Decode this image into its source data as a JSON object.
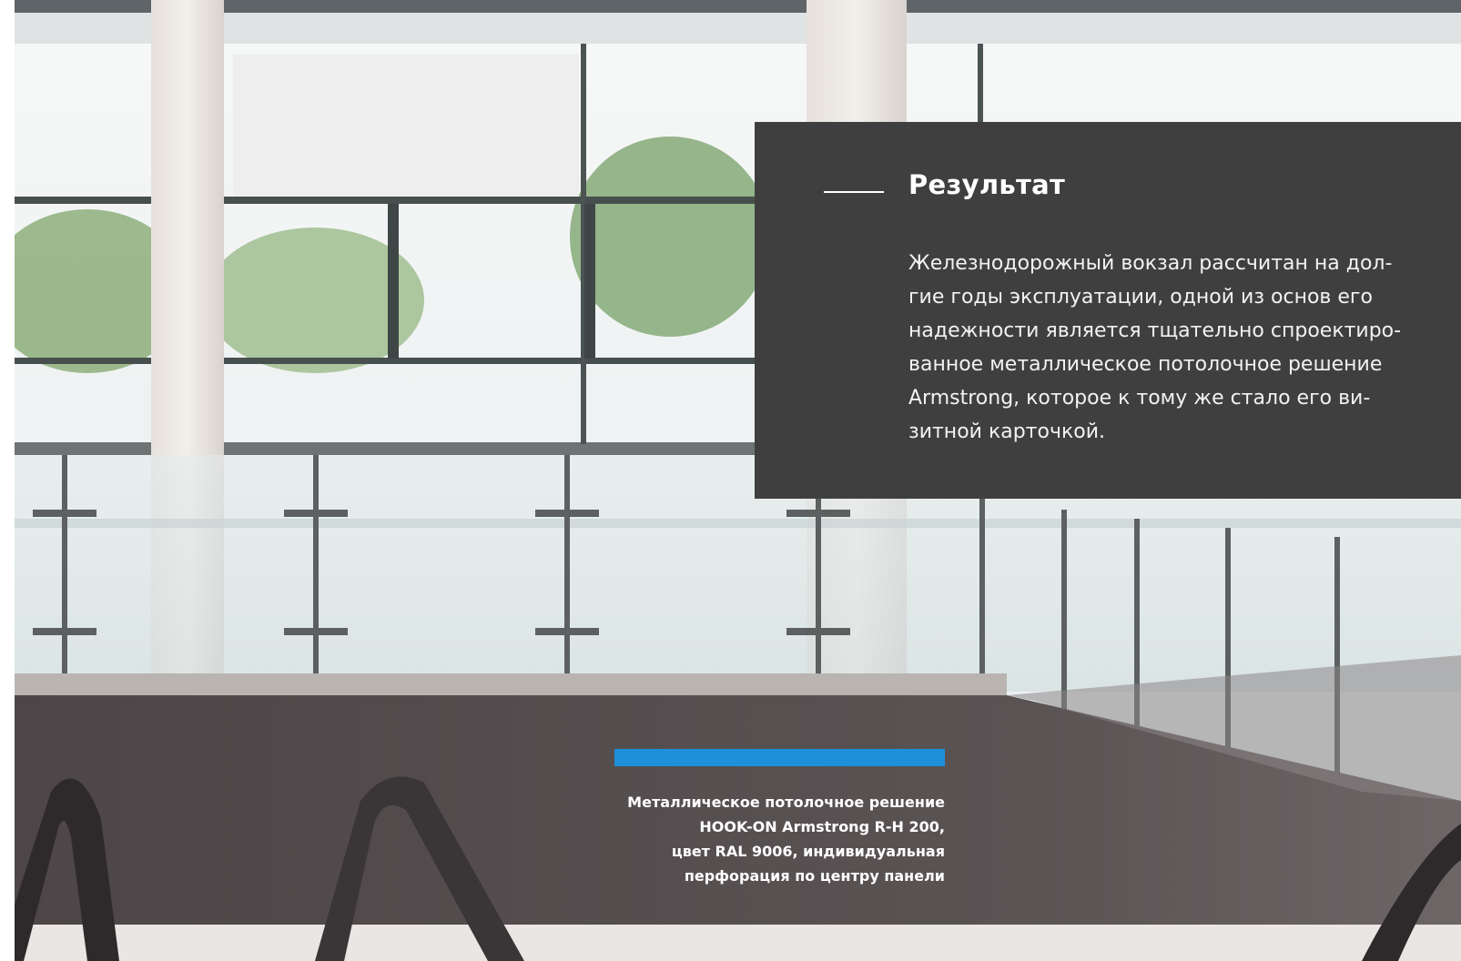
{
  "result": {
    "title": "Результат",
    "body_lines": [
      "Железнодорожный вокзал рассчитан на дол-",
      "гие годы эксплуатации, одной из основ его",
      "надежности является тщательно спроектиро-",
      "ванное металлическое потолочное решение",
      "Armstrong, которое к тому же стало его ви-",
      "зитной карточкой."
    ]
  },
  "caption": {
    "lines": [
      "Металлическое потолочное решение",
      "HOOK-ON Armstrong R-H 200,",
      "цвет RAL 9006, индивидуальная",
      "перфорация по центру панели"
    ]
  },
  "colors": {
    "box_background": "#3f3f3f",
    "accent_bar": "#1e8fd9",
    "text": "#ffffff"
  }
}
